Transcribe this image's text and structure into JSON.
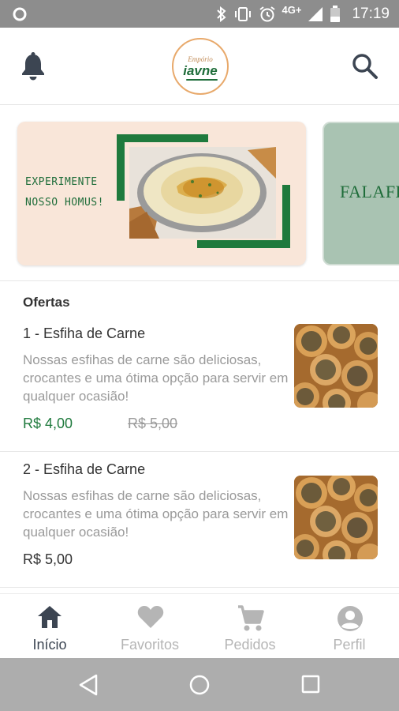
{
  "status_bar": {
    "time": "17:19",
    "network": "4G+"
  },
  "header": {
    "logo": {
      "top_text": "Empório",
      "main_text": "iavne"
    },
    "icons": [
      "bell-icon",
      "search-icon"
    ]
  },
  "banners": [
    {
      "tagline_line1": "EXPERIMENTE",
      "tagline_line2": "NOSSO HOMUS!"
    },
    {
      "text": "FALAFEL"
    }
  ],
  "offers": {
    "title": "Ofertas",
    "items": [
      {
        "title": "1 - Esfiha de Carne",
        "description": "Nossas esfihas de carne são deliciosas, crocantes e uma ótima opção para servir em qualquer ocasião!",
        "price": "R$ 4,00",
        "old_price": "R$ 5,00",
        "price_color": "#1f7a3d"
      },
      {
        "title": "2 - Esfiha de Carne",
        "description": "Nossas esfihas de carne são deliciosas, crocantes e uma ótima opção para servir em qualquer ocasião!",
        "price": "R$ 5,00",
        "price_color": "#333333"
      }
    ]
  },
  "bottom_nav": {
    "items": [
      {
        "label": "Início",
        "icon": "home-icon",
        "active": true
      },
      {
        "label": "Favoritos",
        "icon": "heart-icon",
        "active": false
      },
      {
        "label": "Pedidos",
        "icon": "cart-icon",
        "active": false
      },
      {
        "label": "Perfil",
        "icon": "user-icon",
        "active": false
      }
    ],
    "active_color": "#3c4552",
    "inactive_color": "#b5b5b5"
  },
  "colors": {
    "brand_green": "#1f7a3d",
    "banner_bg": "#f9e6d9",
    "banner2_bg": "#a9c3b2"
  }
}
